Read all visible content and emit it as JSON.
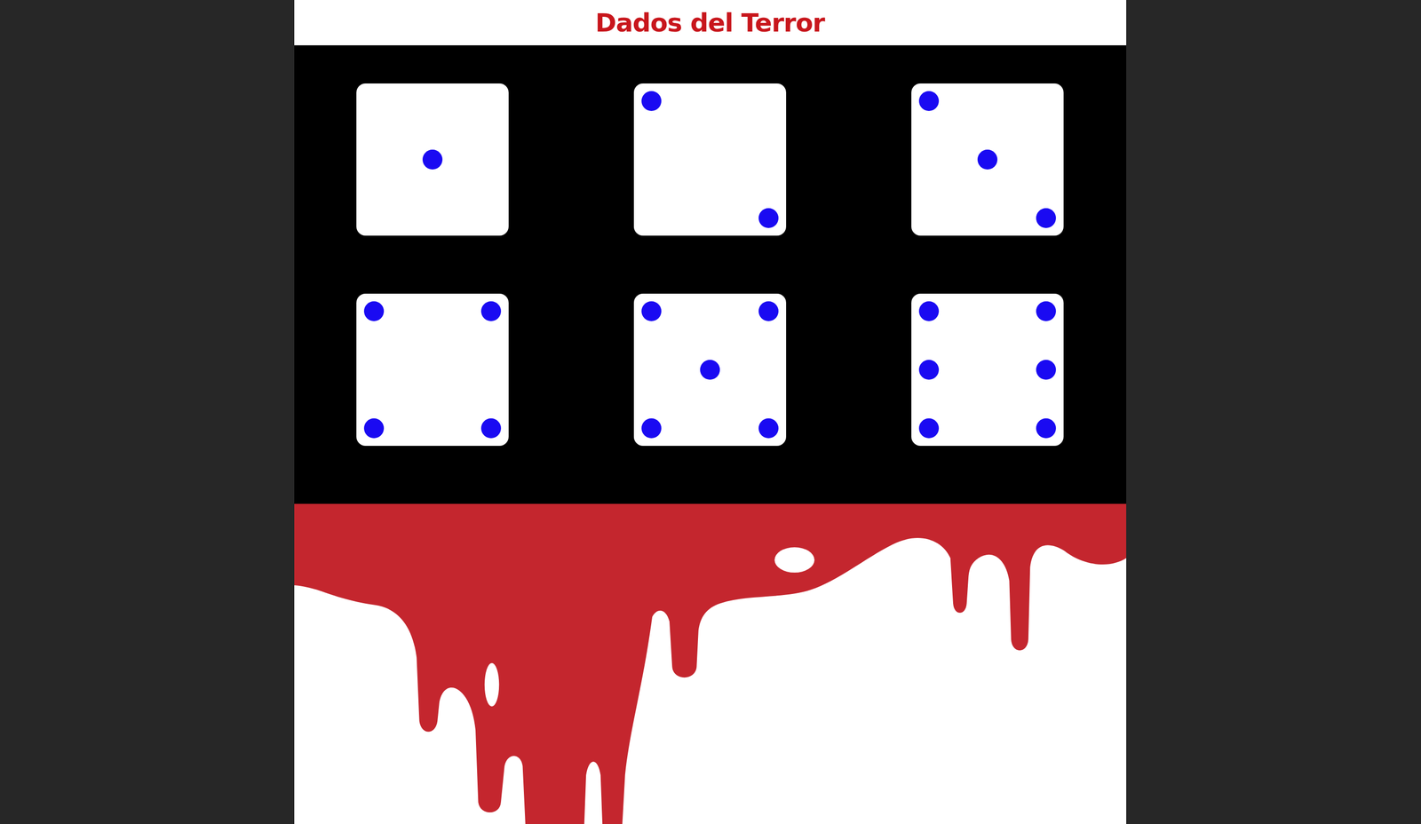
{
  "header": {
    "title": "Dados del Terror"
  },
  "dice": [
    {
      "pips": [
        4
      ]
    },
    {
      "pips": [
        0,
        8
      ]
    },
    {
      "pips": [
        0,
        4,
        8
      ]
    },
    {
      "pips": [
        0,
        2,
        6,
        8
      ]
    },
    {
      "pips": [
        0,
        2,
        4,
        6,
        8
      ]
    },
    {
      "pips": [
        0,
        2,
        3,
        5,
        6,
        8
      ]
    }
  ]
}
